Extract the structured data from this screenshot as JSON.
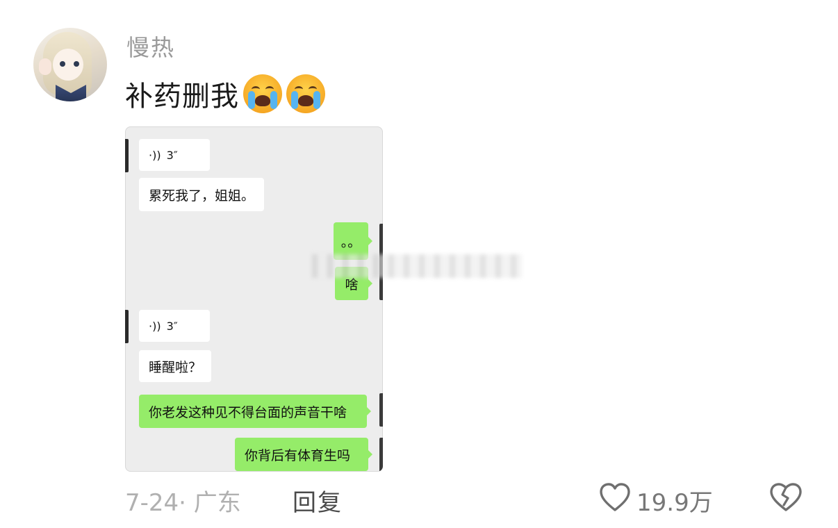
{
  "user": {
    "name": "慢热"
  },
  "comment": {
    "text": "补药删我",
    "emojis": [
      "loudly-crying-face-icon",
      "loudly-crying-face-icon"
    ]
  },
  "chat_image": {
    "messages": [
      {
        "side": "left",
        "type": "voice",
        "duration": "3″"
      },
      {
        "side": "left",
        "type": "text",
        "text": "累死我了，姐姐。"
      },
      {
        "side": "right",
        "type": "text",
        "text": "。。"
      },
      {
        "side": "right",
        "type": "text",
        "text": "啥"
      },
      {
        "side": "left",
        "type": "voice",
        "duration": "3″"
      },
      {
        "side": "left",
        "type": "text",
        "text": "睡醒啦？"
      },
      {
        "side": "right",
        "type": "text",
        "text": "你老发这种见不得台面的声音干啥"
      },
      {
        "side": "right",
        "type": "text",
        "text": "你背后有体育生吗"
      }
    ]
  },
  "footer": {
    "date_location": "7-24· 广东",
    "reply_label": "回复",
    "like_count": "19.9万"
  },
  "colors": {
    "sent_bubble": "#95ec69",
    "received_bubble": "#ffffff",
    "chat_bg": "#ededed"
  }
}
